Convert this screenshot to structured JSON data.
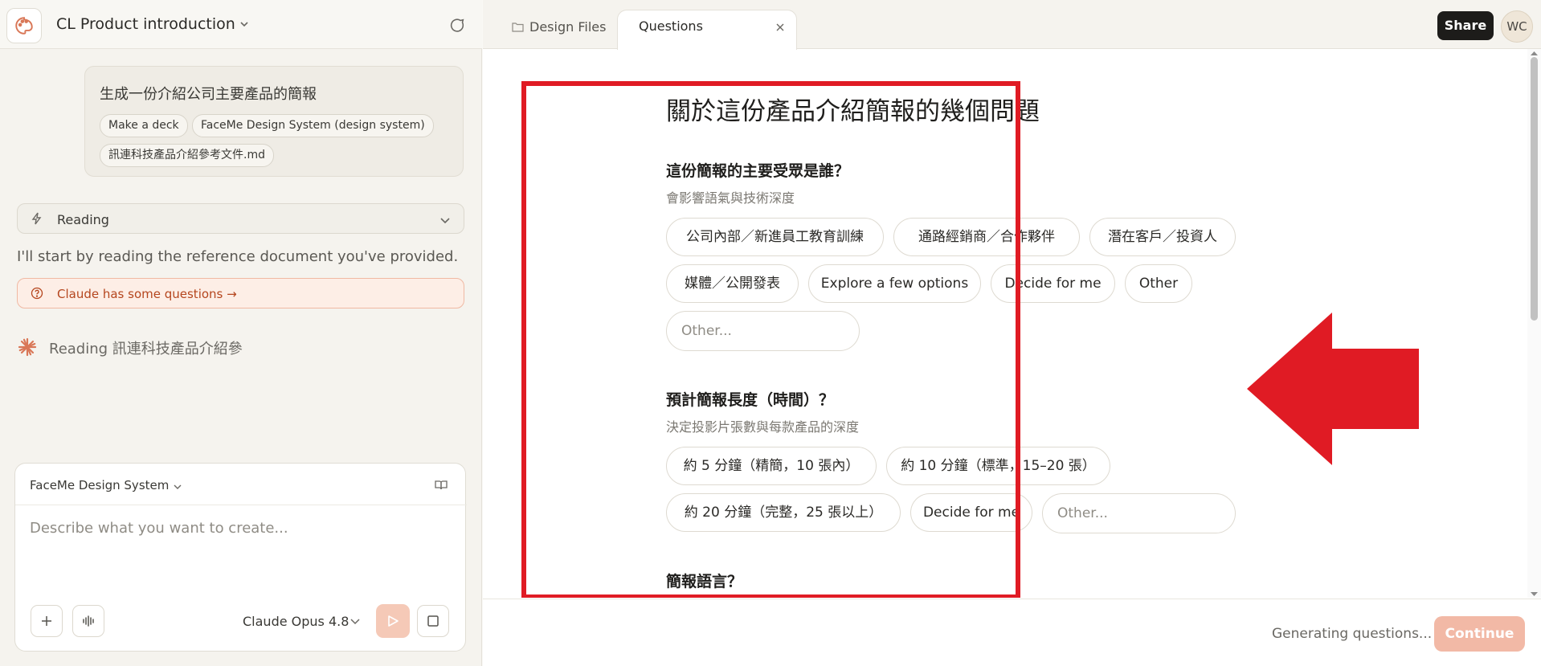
{
  "sidebar": {
    "project_title": "CL Product introduction",
    "user_message": {
      "text": "生成一份介紹公司主要產品的簡報",
      "tags": [
        "Make a deck",
        "FaceMe Design System (design system)",
        "訊連科技產品介紹參考文件.md"
      ]
    },
    "reading_label": "Reading",
    "assistant_text": "I'll start by reading the reference document you've provided.",
    "questions_pill": "Claude has some questions →",
    "reading_status": "Reading 訊連科技產品介紹參",
    "composer": {
      "design_system": "FaceMe Design System",
      "placeholder": "Describe what you want to create...",
      "model": "Claude Opus 4.8"
    }
  },
  "tabs": {
    "design_files": "Design Files",
    "questions": "Questions"
  },
  "header": {
    "share": "Share",
    "avatar_initials": "WC"
  },
  "questions": {
    "title": "關於這份產品介紹簡報的幾個問題",
    "q1": {
      "heading": "這份簡報的主要受眾是誰？",
      "subtitle": "會影響語氣與技術深度",
      "options": [
        "公司內部／新進員工教育訓練",
        "通路經銷商／合作夥伴",
        "潛在客戶／投資人",
        "媒體／公開發表",
        "Explore a few options",
        "Decide for me",
        "Other"
      ],
      "other_placeholder": "Other..."
    },
    "q2": {
      "heading": "預計簡報長度（時間）？",
      "subtitle": "決定投影片張數與每款產品的深度",
      "options": [
        "約 5 分鐘（精簡，10 張內）",
        "約 10 分鐘（標準，15–20 張）",
        "約 20 分鐘（完整，25 張以上）",
        "Decide for me"
      ],
      "other_placeholder": "Other..."
    },
    "q3": {
      "heading": "簡報語言？"
    }
  },
  "footer": {
    "status": "Generating questions...",
    "continue": "Continue"
  },
  "colors": {
    "accent": "#e01b24",
    "claude_orange": "#d97757",
    "continue_disabled": "#f2b9a6"
  }
}
